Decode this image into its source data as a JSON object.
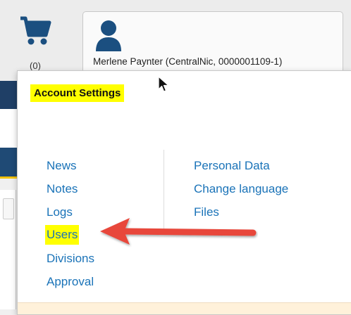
{
  "cart": {
    "icon": "shopping-cart-icon",
    "count_label": "(0)"
  },
  "account": {
    "icon": "user-icon",
    "user_label": "Merlene Paynter (CentralNic, 0000001109-1)"
  },
  "dropdown": {
    "title": "Account Settings",
    "left_items": [
      {
        "label": "News"
      },
      {
        "label": "Notes"
      },
      {
        "label": "Logs"
      },
      {
        "label": "Users",
        "highlighted": true
      },
      {
        "label": "Divisions"
      },
      {
        "label": "Approval"
      }
    ],
    "right_items": [
      {
        "label": "Personal Data"
      },
      {
        "label": "Change language"
      },
      {
        "label": "Files"
      }
    ]
  },
  "colors": {
    "highlight": "#ffff00",
    "link": "#1a73b8",
    "arrow": "#e8473b",
    "navy": "#1f3f66"
  }
}
